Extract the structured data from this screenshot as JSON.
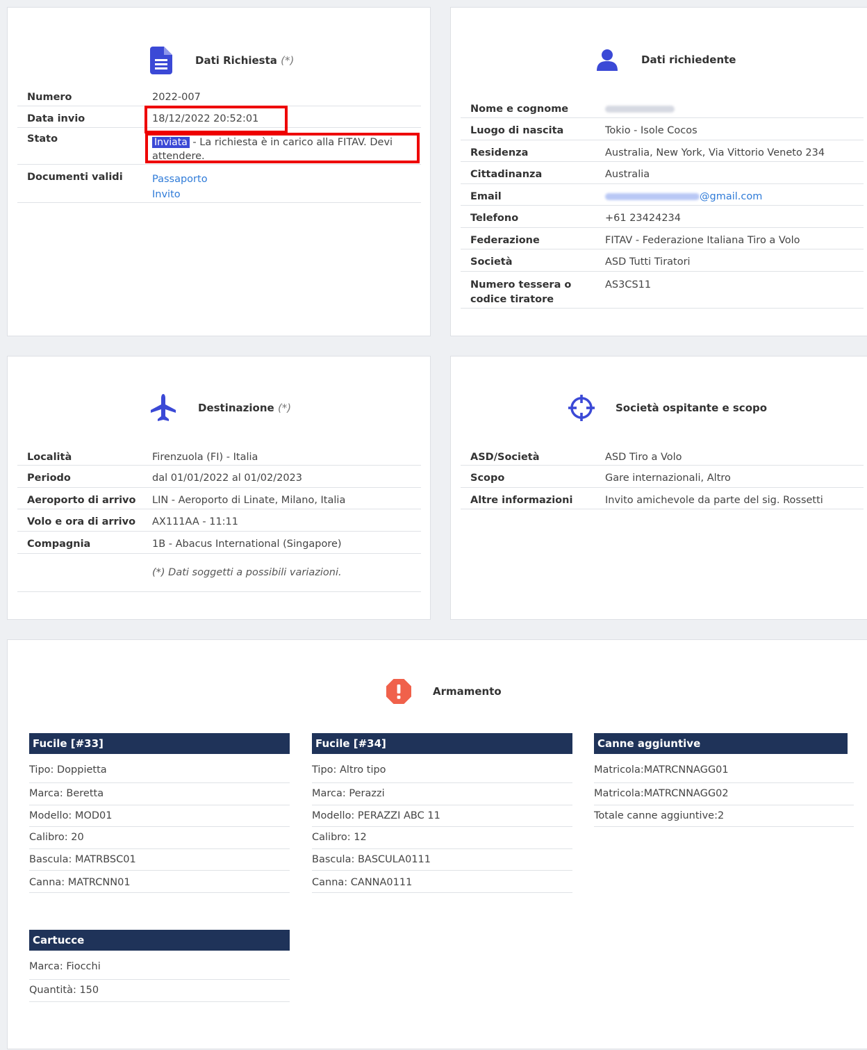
{
  "dati_richiesta": {
    "title": "Dati Richiesta",
    "note": "(*)",
    "rows": {
      "numero_label": "Numero",
      "numero_value": "2022-007",
      "data_invio_label": "Data invio",
      "data_invio_value": "18/12/2022 20:52:01",
      "stato_label": "Stato",
      "stato_badge": "Inviata",
      "stato_text": " - La richiesta è in carico alla FITAV. Devi attendere.",
      "documenti_label": "Documenti validi",
      "documento_1": "Passaporto",
      "documento_2": "Invito"
    }
  },
  "dati_richiedente": {
    "title": "Dati richiedente",
    "rows": [
      {
        "label": "Nome e cognome",
        "value": ""
      },
      {
        "label": "Luogo di nascita",
        "value": "Tokio - Isole Cocos"
      },
      {
        "label": "Residenza",
        "value": "Australia, New York, Via Vittorio Veneto 234"
      },
      {
        "label": "Cittadinanza",
        "value": "Australia"
      },
      {
        "label": "Email",
        "value": "@gmail.com"
      },
      {
        "label": "Telefono",
        "value": "+61 23424234"
      },
      {
        "label": "Federazione",
        "value": "FITAV - Federazione Italiana Tiro a Volo"
      },
      {
        "label": "Società",
        "value": "ASD Tutti Tiratori"
      },
      {
        "label": "Numero tessera o codice tiratore",
        "value": "AS3CS11"
      }
    ]
  },
  "destinazione": {
    "title": "Destinazione",
    "note": "(*)",
    "rows": [
      {
        "label": "Località",
        "value": "Firenzuola (FI) - Italia"
      },
      {
        "label": "Periodo",
        "value": "dal 01/01/2022 al 01/02/2023"
      },
      {
        "label": "Aeroporto di arrivo",
        "value": "LIN - Aeroporto di Linate, Milano, Italia"
      },
      {
        "label": "Volo e ora di arrivo",
        "value": "AX111AA - 11:11"
      },
      {
        "label": "Compagnia",
        "value": "1B - Abacus International (Singapore)"
      }
    ],
    "footnote": "(*) Dati soggetti a possibili variazioni."
  },
  "societa": {
    "title": "Società ospitante e scopo",
    "rows": [
      {
        "label": "ASD/Società",
        "value": "ASD Tiro a Volo"
      },
      {
        "label": "Scopo",
        "value": "Gare internazionali, Altro"
      },
      {
        "label": "Altre informazioni",
        "value": "Invito amichevole da parte del sig. Rossetti"
      }
    ]
  },
  "armamento": {
    "title": "Armamento",
    "fucile1": {
      "title": "Fucile [#33]",
      "items": [
        "Tipo: Doppietta",
        "Marca: Beretta",
        "Modello: MOD01",
        "Calibro: 20",
        "Bascula: MATRBSC01",
        "Canna: MATRCNN01"
      ]
    },
    "fucile2": {
      "title": "Fucile [#34]",
      "items": [
        "Tipo: Altro tipo",
        "Marca: Perazzi",
        "Modello: PERAZZI ABC 11",
        "Calibro: 12",
        "Bascula: BASCULA0111",
        "Canna: CANNA0111"
      ]
    },
    "canne": {
      "title": "Canne aggiuntive",
      "items": [
        "Matricola:MATRCNNAGG01",
        "Matricola:MATRCNNAGG02",
        "Totale canne aggiuntive:2"
      ]
    },
    "cartucce": {
      "title": "Cartucce",
      "items": [
        "Marca: Fiocchi",
        "Quantità: 150"
      ]
    }
  },
  "icons": {
    "document": "document-icon",
    "person": "person-icon",
    "plane": "plane-icon",
    "target": "crosshair-icon",
    "alert": "alert-icon"
  },
  "colors": {
    "accent": "#3b49d6",
    "section_bar": "#1f3359",
    "highlight_box": "#ee0000",
    "alert": "#f0614b",
    "link": "#2f7bd8"
  }
}
